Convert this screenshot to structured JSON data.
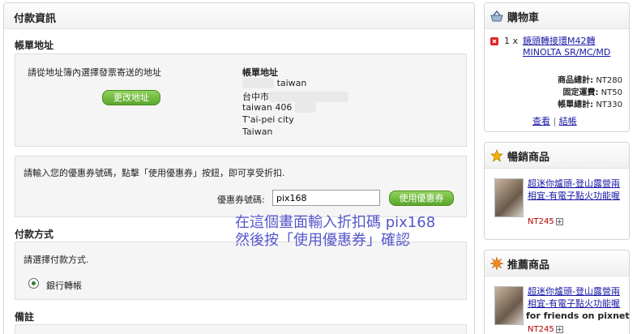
{
  "payment_info": {
    "title": "付款資訊",
    "billing": {
      "section_title": "帳單地址",
      "prompt": "請從地址簿內選擇發票寄送的地址",
      "change_button": "更改地址",
      "address_heading": "帳單地址",
      "address_lines": [
        "台中市",
        "taiwan 406",
        "T'ai-pei city",
        "Taiwan"
      ],
      "line1_suffix": "taiwan"
    },
    "coupon": {
      "instruction": "請輸入您的優惠券號碼，點擊「使用優惠券」按鈕，即可享受折扣.",
      "label": "優惠券號碼:",
      "value": "pix168",
      "button": "使用優惠券"
    },
    "payment_method": {
      "section_title": "付款方式",
      "prompt": "請選擇付款方式.",
      "option": "銀行轉帳"
    },
    "notes": {
      "section_title": "備註"
    }
  },
  "annotation": {
    "line1": "在這個畫面輸入折扣碼 pix168",
    "line2": "然後按「使用優惠券」確認"
  },
  "cart": {
    "title": "購物車",
    "item_qty": "1 x",
    "item_name": "鏡頭轉接環M42轉MINOLTA SR/MC/MD",
    "subtotal_label": "商品總計:",
    "subtotal_value": "NT280",
    "shipping_label": "固定運費:",
    "shipping_value": "NT50",
    "total_label": "帳單總計:",
    "total_value": "NT330",
    "view_link": "查看",
    "separator": "|",
    "checkout_link": "結帳"
  },
  "bestsellers": {
    "title": "暢銷商品",
    "item_name": "超迷你爐頭-登山露營兩相宜-有電子點火功能喔",
    "price": "NT245"
  },
  "recommended": {
    "title": "推薦商品",
    "item_name": "超迷你爐頭-登山露營兩相宜-有電子點火功能喔",
    "price": "NT245",
    "watermark": "for friends on pixnet"
  },
  "colors": {
    "accent_green": "#5aa72c",
    "link_blue": "#1a1aa6",
    "price_red": "#b30000",
    "annotation_blue": "#5555cc"
  }
}
